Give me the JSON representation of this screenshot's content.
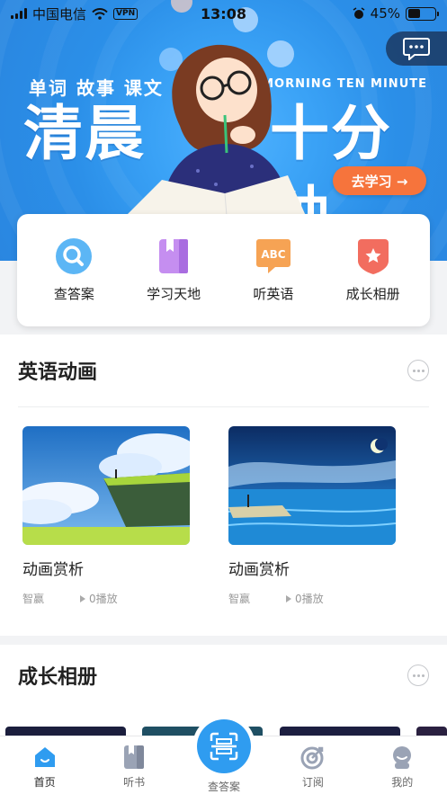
{
  "status_bar": {
    "carrier": "中国电信",
    "vpn": "VPN",
    "time": "13:08",
    "battery": "45%",
    "battery_level": 0.45
  },
  "banner": {
    "subtitle": "单词 故事 课文",
    "title_left": "清晨",
    "title_right": "十分钟",
    "english": "MORNING TEN MINUTE",
    "cta_label": "去学习 →"
  },
  "quick_menu": [
    {
      "label": "查答案",
      "icon": "search-icon"
    },
    {
      "label": "学习天地",
      "icon": "bookmark-book-icon"
    },
    {
      "label": "听英语",
      "icon": "abc-bubble-icon"
    },
    {
      "label": "成长相册",
      "icon": "star-shield-icon"
    }
  ],
  "sections": {
    "english_animation": {
      "title": "英语动画",
      "cards": [
        {
          "title": "动画赏析",
          "author": "智赢",
          "plays": "0播放"
        },
        {
          "title": "动画赏析",
          "author": "智赢",
          "plays": "0播放"
        }
      ]
    },
    "growth_album": {
      "title": "成长相册"
    }
  },
  "bottom_nav": {
    "home": "首页",
    "listen_book": "听书",
    "check_answer": "查答案",
    "subscribe": "订阅",
    "mine": "我的"
  },
  "colors": {
    "primary_blue": "#2f9cf0",
    "cta_orange": "#f6743c",
    "banner_blue": "#3aa2f6"
  }
}
